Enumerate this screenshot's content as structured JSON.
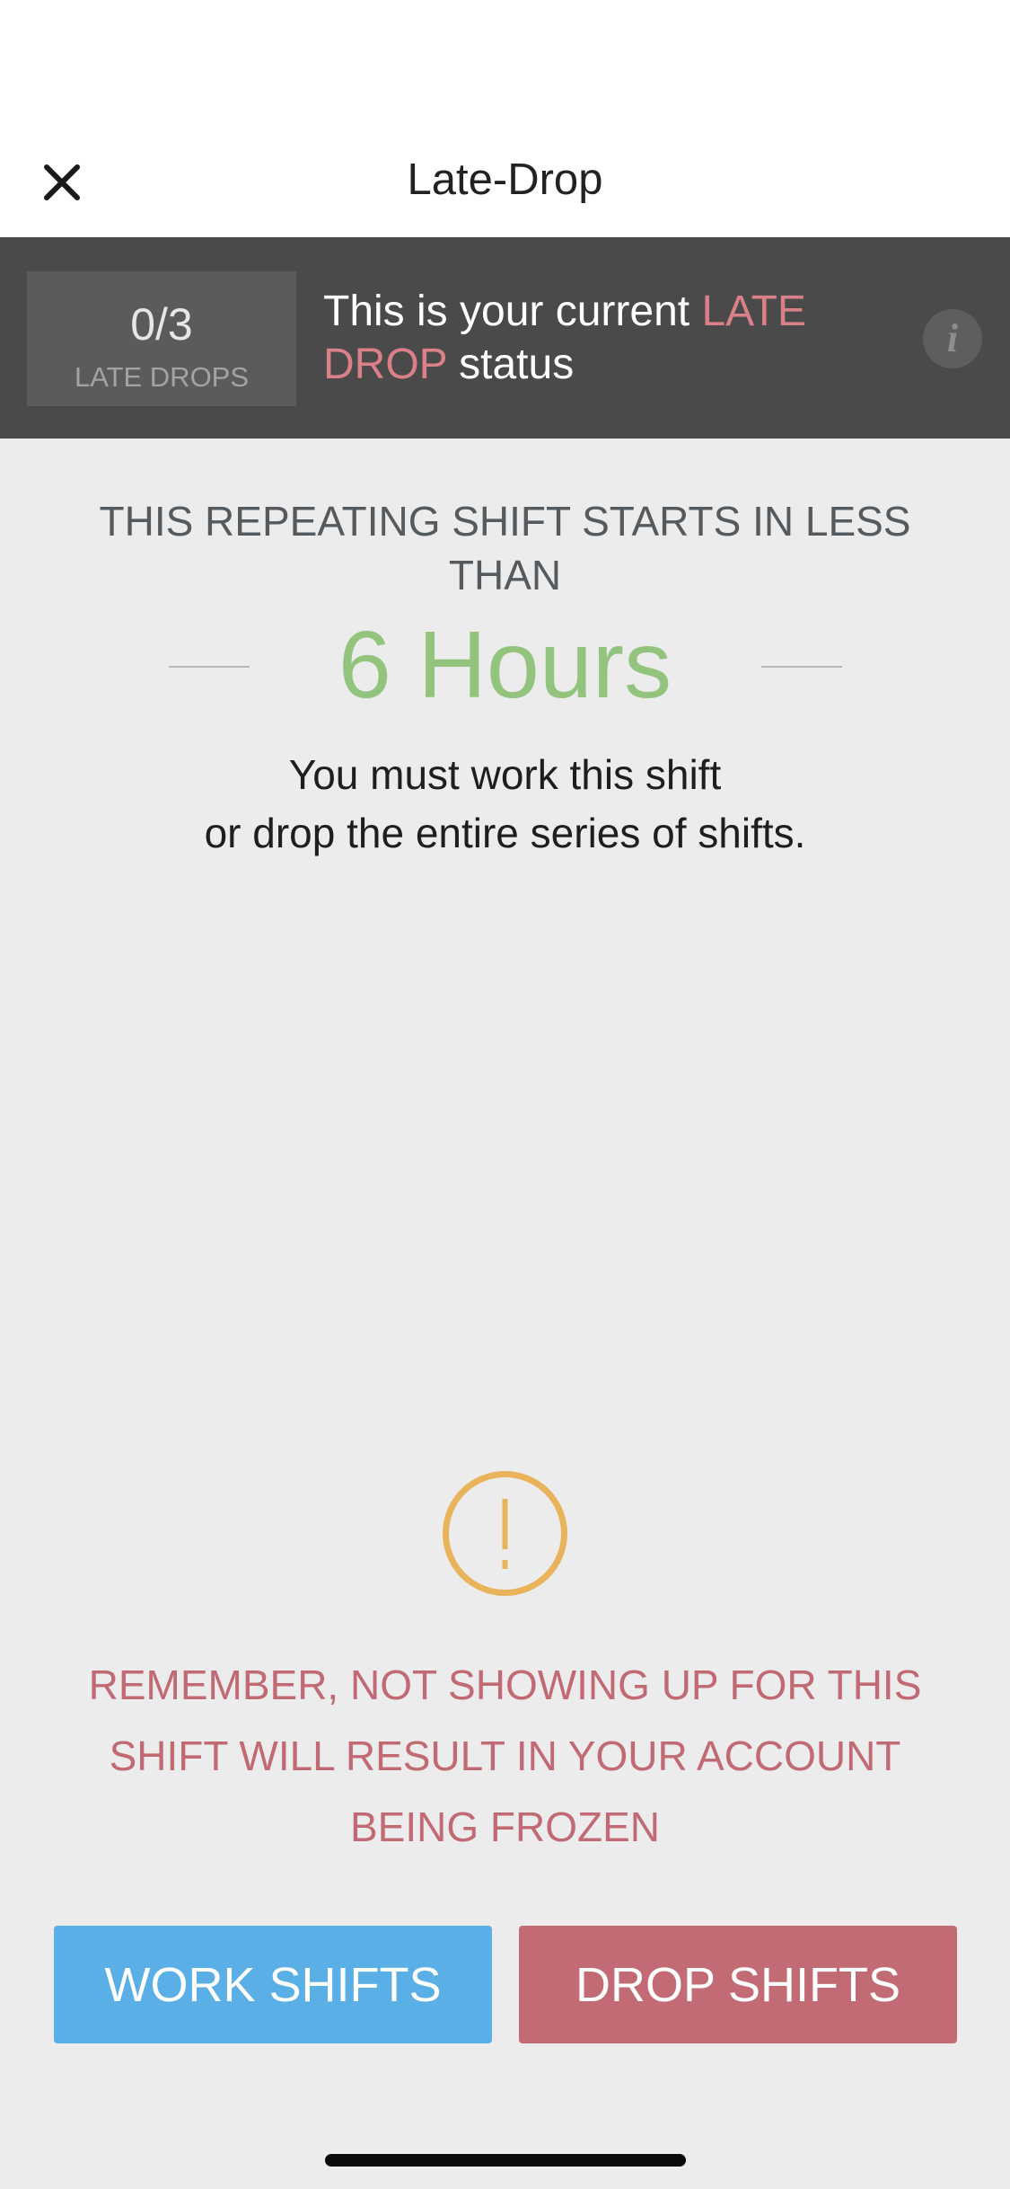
{
  "nav": {
    "title": "Late-Drop",
    "close_icon": "close-x-icon"
  },
  "status": {
    "count": "0/3",
    "count_label": "LATE DROPS",
    "text_prefix": "This is your current ",
    "text_highlight": "LATE DROP",
    "text_suffix": " status",
    "info_icon": "info-icon",
    "info_glyph": "i"
  },
  "shift": {
    "headline": "THIS REPEATING SHIFT STARTS IN LESS THAN",
    "time_value": "6 Hours",
    "instruction_line1": "You must work this shift",
    "instruction_line2": "or drop the entire series of shifts."
  },
  "warning": {
    "icon": "exclamation-circle-icon",
    "text": "REMEMBER, NOT SHOWING UP FOR THIS SHIFT WILL RESULT IN YOUR ACCOUNT BEING FROZEN"
  },
  "actions": {
    "work_label": "WORK SHIFTS",
    "drop_label": "DROP SHIFTS"
  },
  "colors": {
    "highlight_red": "#d98088",
    "time_green": "#93c47d",
    "warning_orange": "#e8b35a",
    "warning_text": "#c26a73",
    "work_button": "#5aafe6",
    "drop_button": "#c26b74",
    "status_bar": "#4a4a4a"
  }
}
